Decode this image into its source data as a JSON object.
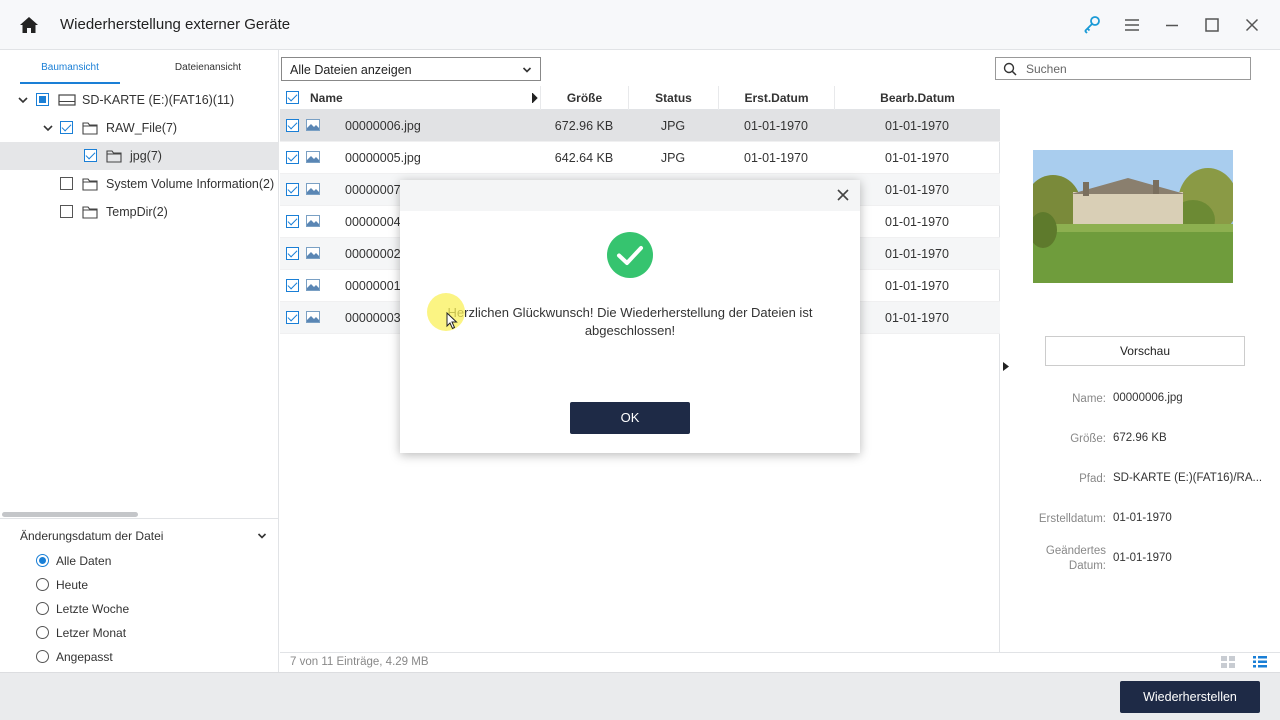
{
  "window": {
    "title": "Wiederherstellung externer Geräte",
    "colors": {
      "accent": "#1a7fd6",
      "dark_button": "#1e2a46",
      "success": "#36c46f"
    }
  },
  "left": {
    "tabs": [
      {
        "label": "Baumansicht"
      },
      {
        "label": "Dateienansicht"
      }
    ],
    "tree": [
      {
        "label": "SD-KARTE (E:)(FAT16)(11)",
        "state": "partial"
      },
      {
        "label": "RAW_File(7)",
        "state": "checked"
      },
      {
        "label": "jpg(7)",
        "state": "checked"
      },
      {
        "label": "System Volume Information(2)",
        "state": "unchecked"
      },
      {
        "label": "TempDir(2)",
        "state": "unchecked"
      }
    ],
    "filter": {
      "title": "Änderungsdatum der Datei",
      "options": [
        {
          "label": "Alle Daten",
          "selected": true
        },
        {
          "label": "Heute",
          "selected": false
        },
        {
          "label": "Letzte Woche",
          "selected": false
        },
        {
          "label": "Letzer Monat",
          "selected": false
        },
        {
          "label": "Angepasst",
          "selected": false
        }
      ]
    }
  },
  "toolbar": {
    "filter_select": "Alle Dateien anzeigen",
    "search_placeholder": "Suchen"
  },
  "table": {
    "columns": [
      "Name",
      "Größe",
      "Status",
      "Erst.Datum",
      "Bearb.Datum"
    ],
    "rows": [
      {
        "name": "00000006.jpg",
        "size": "672.96  KB",
        "status": "JPG",
        "created": "01-01-1970",
        "modified": "01-01-1970"
      },
      {
        "name": "00000005.jpg",
        "size": "642.64  KB",
        "status": "JPG",
        "created": "01-01-1970",
        "modified": "01-01-1970"
      },
      {
        "name": "00000007",
        "size": "",
        "status": "",
        "created": "",
        "modified": "01-01-1970"
      },
      {
        "name": "00000004",
        "size": "",
        "status": "",
        "created": "",
        "modified": "01-01-1970"
      },
      {
        "name": "00000002",
        "size": "",
        "status": "",
        "created": "",
        "modified": "01-01-1970"
      },
      {
        "name": "00000001",
        "size": "",
        "status": "",
        "created": "",
        "modified": "01-01-1970"
      },
      {
        "name": "00000003",
        "size": "",
        "status": "",
        "created": "",
        "modified": "01-01-1970"
      }
    ],
    "status_text": "7 von 11 Einträge, 4.29  MB"
  },
  "details": {
    "preview_button": "Vorschau",
    "props": [
      {
        "label": "Name:",
        "value": "00000006.jpg"
      },
      {
        "label": "Größe:",
        "value": "672.96  KB"
      },
      {
        "label": "Pfad:",
        "value": "SD-KARTE (E:)(FAT16)/RA..."
      },
      {
        "label": "Erstelldatum:",
        "value": "01-01-1970"
      },
      {
        "label": "Geändertes Datum:",
        "value": "01-01-1970"
      }
    ]
  },
  "footer": {
    "recover_button": "Wiederherstellen"
  },
  "dialog": {
    "message": "Herzlichen Glückwunsch! Die Wiederherstellung der Dateien ist abgeschlossen!",
    "ok_label": "OK"
  }
}
